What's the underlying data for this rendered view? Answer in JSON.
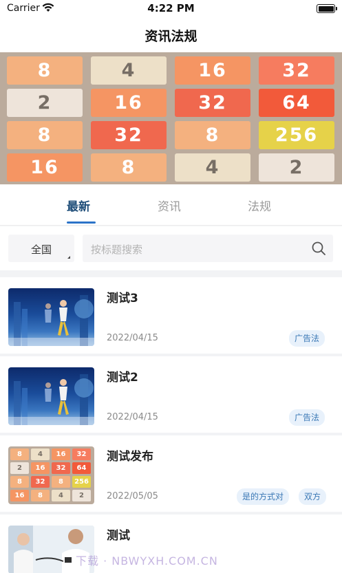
{
  "status_bar": {
    "carrier": "Carrier",
    "time": "4:22 PM"
  },
  "nav": {
    "title": "资讯法规"
  },
  "banner": {
    "rows": [
      [
        {
          "v": "8",
          "bg": "#f4b17f",
          "fg": "#ffffff"
        },
        {
          "v": "4",
          "bg": "#ede0c8",
          "fg": "#776e65"
        },
        {
          "v": "16",
          "bg": "#f59563",
          "fg": "#ffffff"
        },
        {
          "v": "32",
          "bg": "#f67c5f",
          "fg": "#ffffff"
        }
      ],
      [
        {
          "v": "2",
          "bg": "#eee4da",
          "fg": "#776e65"
        },
        {
          "v": "16",
          "bg": "#f59563",
          "fg": "#ffffff"
        },
        {
          "v": "32",
          "bg": "#f0684e",
          "fg": "#ffffff"
        },
        {
          "v": "64",
          "bg": "#f25a3a",
          "fg": "#ffffff"
        }
      ],
      [
        {
          "v": "8",
          "bg": "#f4b17f",
          "fg": "#ffffff"
        },
        {
          "v": "32",
          "bg": "#f0684e",
          "fg": "#ffffff"
        },
        {
          "v": "8",
          "bg": "#f4b17f",
          "fg": "#ffffff"
        },
        {
          "v": "256",
          "bg": "#e6d249",
          "fg": "#ffffff"
        }
      ],
      [
        {
          "v": "16",
          "bg": "#f59563",
          "fg": "#ffffff"
        },
        {
          "v": "8",
          "bg": "#f4b17f",
          "fg": "#ffffff"
        },
        {
          "v": "4",
          "bg": "#ede0c8",
          "fg": "#776e65"
        },
        {
          "v": "2",
          "bg": "#eee4da",
          "fg": "#776e65"
        }
      ]
    ]
  },
  "tabs": [
    {
      "label": "最新",
      "active": true
    },
    {
      "label": "资讯",
      "active": false
    },
    {
      "label": "法规",
      "active": false
    }
  ],
  "filter": {
    "region": "全国",
    "search_placeholder": "按标题搜索"
  },
  "articles": [
    {
      "title": "测试3",
      "date": "2022/04/15",
      "tags": [
        "广告法"
      ],
      "thumb": "dance"
    },
    {
      "title": "测试2",
      "date": "2022/04/15",
      "tags": [
        "广告法"
      ],
      "thumb": "dance"
    },
    {
      "title": "测试发布",
      "date": "2022/05/05",
      "tags": [
        "是的方式对",
        "双方"
      ],
      "thumb": "game"
    },
    {
      "title": "测试",
      "date": "",
      "tags": [],
      "thumb": "doctor"
    }
  ],
  "watermark": "下载 · NBWYXH.COM.CN",
  "colors": {
    "accent": "#2b73c8",
    "tag_bg": "#e8f1fb",
    "tag_text": "#3a78b5"
  }
}
